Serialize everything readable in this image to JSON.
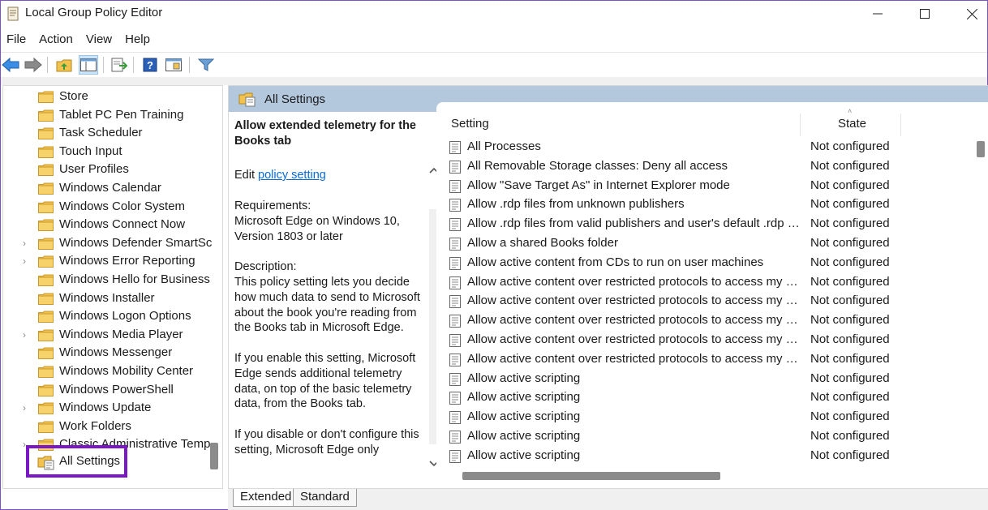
{
  "window": {
    "title": "Local Group Policy Editor"
  },
  "menu": [
    "File",
    "Action",
    "View",
    "Help"
  ],
  "tree": {
    "items": [
      {
        "label": "Store",
        "expandable": false
      },
      {
        "label": "Tablet PC Pen Training",
        "expandable": false
      },
      {
        "label": "Task Scheduler",
        "expandable": false
      },
      {
        "label": "Touch Input",
        "expandable": false
      },
      {
        "label": "User Profiles",
        "expandable": false
      },
      {
        "label": "Windows Calendar",
        "expandable": false
      },
      {
        "label": "Windows Color System",
        "expandable": false
      },
      {
        "label": "Windows Connect Now",
        "expandable": false
      },
      {
        "label": "Windows Defender SmartSc",
        "expandable": true
      },
      {
        "label": "Windows Error Reporting",
        "expandable": true
      },
      {
        "label": "Windows Hello for Business",
        "expandable": false
      },
      {
        "label": "Windows Installer",
        "expandable": false
      },
      {
        "label": "Windows Logon Options",
        "expandable": false
      },
      {
        "label": "Windows Media Player",
        "expandable": true
      },
      {
        "label": "Windows Messenger",
        "expandable": false
      },
      {
        "label": "Windows Mobility Center",
        "expandable": false
      },
      {
        "label": "Windows PowerShell",
        "expandable": false
      },
      {
        "label": "Windows Update",
        "expandable": true
      },
      {
        "label": "Work Folders",
        "expandable": false
      },
      {
        "label": "Classic Administrative Temp",
        "expandable": true
      }
    ],
    "selected": "All Settings"
  },
  "right_header": {
    "title": "All Settings"
  },
  "description": {
    "title": "Allow extended telemetry for the Books tab",
    "edit_prefix": "Edit ",
    "edit_link": "policy setting",
    "body": "Requirements:\nMicrosoft Edge on Windows 10, Version 1803 or later\n\nDescription:\nThis policy setting lets you decide how much data to send to Microsoft about the book you're reading from the Books tab in Microsoft Edge.\n\nIf you enable this setting, Microsoft Edge sends additional telemetry data, on top of the basic telemetry data, from the Books tab.\n\nIf you disable or don't configure this setting, Microsoft Edge only"
  },
  "list": {
    "columns": {
      "setting": "Setting",
      "state": "State"
    },
    "rows": [
      {
        "name": "All Processes",
        "state": "Not configured"
      },
      {
        "name": "All Removable Storage classes: Deny all access",
        "state": "Not configured"
      },
      {
        "name": "Allow \"Save Target As\" in Internet Explorer mode",
        "state": "Not configured"
      },
      {
        "name": "Allow .rdp files from unknown publishers",
        "state": "Not configured"
      },
      {
        "name": "Allow .rdp files from valid publishers and user's default .rdp s...",
        "state": "Not configured"
      },
      {
        "name": "Allow a shared Books folder",
        "state": "Not configured"
      },
      {
        "name": "Allow active content from CDs to run on user machines",
        "state": "Not configured"
      },
      {
        "name": "Allow active content over restricted protocols to access my co...",
        "state": "Not configured"
      },
      {
        "name": "Allow active content over restricted protocols to access my co...",
        "state": "Not configured"
      },
      {
        "name": "Allow active content over restricted protocols to access my co...",
        "state": "Not configured"
      },
      {
        "name": "Allow active content over restricted protocols to access my co...",
        "state": "Not configured"
      },
      {
        "name": "Allow active content over restricted protocols to access my co...",
        "state": "Not configured"
      },
      {
        "name": "Allow active scripting",
        "state": "Not configured"
      },
      {
        "name": "Allow active scripting",
        "state": "Not configured"
      },
      {
        "name": "Allow active scripting",
        "state": "Not configured"
      },
      {
        "name": "Allow active scripting",
        "state": "Not configured"
      },
      {
        "name": "Allow active scripting",
        "state": "Not configured"
      }
    ]
  },
  "tabs": [
    "Extended",
    "Standard"
  ],
  "colors": {
    "accent_highlight": "#7a18c6",
    "header_bg": "#b4c8dd",
    "link": "#0a6bd8",
    "folder": "#f2c14e"
  },
  "icons": {
    "back": "arrow-left-icon",
    "forward": "arrow-right-icon",
    "up": "folder-up-icon",
    "show_hide": "console-tree-icon",
    "export": "export-list-icon",
    "help": "help-icon",
    "properties": "properties-icon",
    "filter": "filter-icon"
  }
}
